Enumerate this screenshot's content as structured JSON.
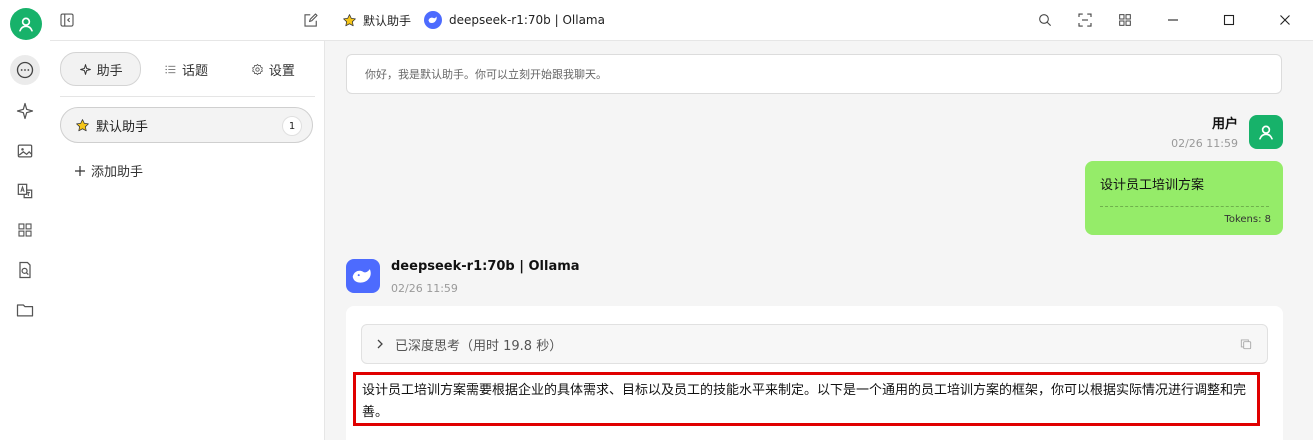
{
  "topbar": {
    "assistant_name": "默认助手",
    "model_label": "deepseek-r1:70b | Ollama"
  },
  "sidebar": {
    "tabs": [
      {
        "label": "助手",
        "icon": "sparkle-icon"
      },
      {
        "label": "话题",
        "icon": "list-icon"
      },
      {
        "label": "设置",
        "icon": "gear-icon"
      }
    ],
    "assistants": [
      {
        "name": "默认助手",
        "count": "1",
        "icon": "star-icon"
      }
    ],
    "add_label": "添加助手"
  },
  "chat": {
    "greeting": "你好，我是默认助手。你可以立刻开始跟我聊天。",
    "user": {
      "name": "用户",
      "time": "02/26 11:59",
      "message": "设计员工培训方案",
      "tokens": "Tokens: 8"
    },
    "assistant": {
      "name": "deepseek-r1:70b | Ollama",
      "time": "02/26 11:59",
      "thinking_label": "已深度思考（用时 19.8 秒）",
      "answer": "设计员工培训方案需要根据企业的具体需求、目标以及员工的技能水平来制定。以下是一个通用的员工培训方案的框架，你可以根据实际情况进行调整和完善。"
    }
  },
  "colors": {
    "brand_green": "#17b26a",
    "user_bubble": "#95ec69",
    "deepseek_blue": "#4d6bfe",
    "highlight_red": "#e00000"
  }
}
